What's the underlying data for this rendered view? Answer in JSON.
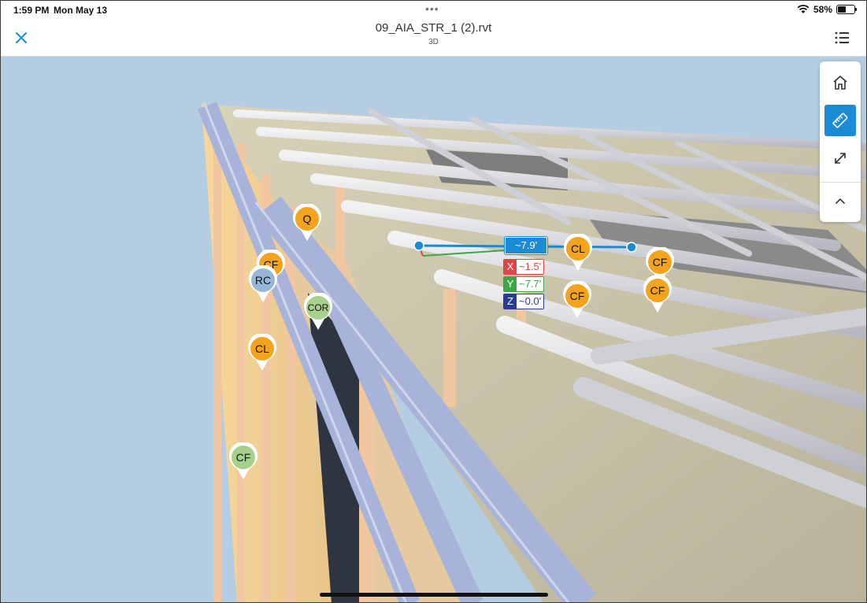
{
  "status": {
    "time": "1:59 PM",
    "date": "Mon May 13",
    "dots": "•••",
    "battery_pct_text": "58%",
    "battery_level": 0.58
  },
  "nav": {
    "title": "09_AIA_STR_1 (2).rvt",
    "subtitle": "3D",
    "close_icon": "close-icon",
    "list_icon": "list-icon"
  },
  "toolbar": {
    "tools": [
      "home-icon",
      "measure-ruler-icon",
      "expand-icon",
      "chevron-up-icon"
    ],
    "active_tool": "measure-ruler-icon"
  },
  "measurement": {
    "distance": "~7.9'",
    "x_key": "X",
    "x": "~1.5'",
    "y_key": "Y",
    "y": "~7.7'",
    "z_key": "Z",
    "z": "~0.0'"
  },
  "pins": [
    {
      "label": "Q",
      "color": "#f4a41c"
    },
    {
      "label": "CF",
      "color": "#f4a41c"
    },
    {
      "label": "RC",
      "color": "#97b7d9"
    },
    {
      "label": "COR",
      "color": "#a8d08d"
    },
    {
      "label": "CL",
      "color": "#f4a41c"
    },
    {
      "label": "CF",
      "color": "#a8d08d"
    },
    {
      "label": "CL",
      "color": "#f4a41c"
    },
    {
      "label": "CF",
      "color": "#f4a41c"
    },
    {
      "label": "CF",
      "color": "#f4a41c"
    },
    {
      "label": "CF",
      "color": "#f4a41c"
    }
  ],
  "colors": {
    "accent": "#1a8bd4",
    "sky": "#b5cde3",
    "x_axis": "#e04545",
    "y_axis": "#3aa845",
    "z_axis": "#2a3a9a"
  }
}
